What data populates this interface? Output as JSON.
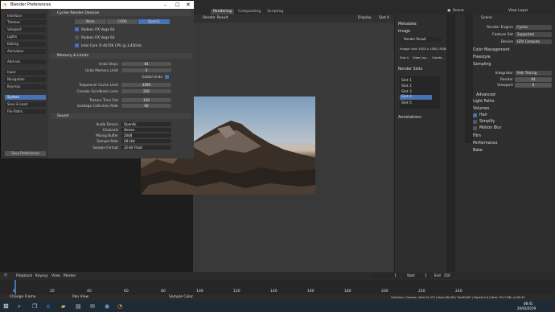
{
  "prefs": {
    "title": "Blender Preferences",
    "nav": [
      "Interface",
      "Themes",
      "Viewport",
      "Lights",
      "Editing",
      "Animation",
      "Add-ons",
      "Input",
      "Navigation",
      "Keymap",
      "System",
      "Save & Load",
      "File Paths"
    ],
    "save_btn": "Save Preferences",
    "cycles_h": "Cycles Render Devices",
    "dev_tabs": [
      "None",
      "CUDA",
      "OpenCL"
    ],
    "devices": [
      "Radeon RX Vega 64",
      "Radeon RX Vega 64",
      "Intel Core i5-4670K CPU @ 3.40GHz"
    ],
    "mem_h": "Memory & Limits",
    "undo_steps_l": "Undo Steps",
    "undo_steps": "64",
    "undo_mem_l": "Undo Memory Limit",
    "undo_mem": "0",
    "global_undo": "Global Undo",
    "seq_cache_l": "Sequencer Cache Limit",
    "seq_cache": "4096",
    "scrollback_l": "Console Scrollback Lines",
    "scrollback": "256",
    "tex_timeout_l": "Texture Time Out",
    "tex_timeout": "120",
    "gc_rate_l": "Garbage Collection Rate",
    "gc_rate": "60",
    "sound_h": "Sound",
    "audio_dev_l": "Audio Device",
    "audio_dev": "OpenAL",
    "channels_l": "Channels",
    "channels": "Stereo",
    "mix_buf_l": "Mixing Buffer",
    "mix_buf": "2048",
    "sample_rate_l": "Sample Rate",
    "sample_rate": "48 kHz",
    "sample_fmt_l": "Sample Format",
    "sample_fmt": "32-bit Float"
  },
  "topbar": {
    "tabs": [
      "Rendering",
      "Compositing",
      "Scripting"
    ],
    "scene": "Scene",
    "view_layer": "View Layer"
  },
  "viewport": {
    "render_result": "Render Result",
    "view": "Display",
    "slot": "Slot 4",
    "view_layer": "View Layer",
    "combined": "Combined"
  },
  "side_n": {
    "metadata": "Metadata",
    "image": "Image",
    "render_result": "Render Result",
    "image_info": "Image: size 1920 x 1080, RGBA f...",
    "slot": "Slot 4",
    "view_layer": "View Lay...",
    "combined": "Combi...",
    "render_slots": "Render Slots",
    "slots": [
      "Slot 1",
      "Slot 2",
      "Slot 3",
      "Slot 4",
      "Slot 5"
    ],
    "annotations": "Annotations"
  },
  "props": {
    "scene": "Scene",
    "render_engine_l": "Render Engine",
    "render_engine": "Cycles",
    "feature_set_l": "Feature Set",
    "feature_set": "Supported",
    "device_l": "Device",
    "device": "GPU Compute",
    "color_mgmt": "Color Management",
    "freestyle": "Freestyle",
    "sampling": "Sampling",
    "integrator_l": "Integrator",
    "integrator": "Path Tracing",
    "render_l": "Render",
    "render": "64",
    "viewport_l": "Viewport",
    "viewport": "8",
    "advanced": "Advanced",
    "light_paths": "Light Paths",
    "volumes": "Volumes",
    "hair": "Hair",
    "simplify": "Simplify",
    "motion_blur": "Motion Blur",
    "film": "Film",
    "performance": "Performance",
    "bake": "Bake"
  },
  "timeline": {
    "menu": [
      "Playback",
      "Keying",
      "View",
      "Marker"
    ],
    "frame": "1",
    "start_l": "Start",
    "start": "1",
    "end_l": "End",
    "end": "250",
    "ticks": [
      "0",
      "20",
      "40",
      "60",
      "80",
      "100",
      "120",
      "140",
      "160",
      "180",
      "200",
      "220",
      "240"
    ]
  },
  "status": {
    "left": "Change Frame",
    "mid": "Pan View",
    "mid2": "Sample Color",
    "right": "Collection | Camera | Verts:31,375 | Faces:56,169 | Tris:60,847 | Objects:1/4 | Mem: 131.7 MB | v2.80.45"
  },
  "taskbar": {
    "time": "08:41",
    "date": "20/03/2019"
  }
}
